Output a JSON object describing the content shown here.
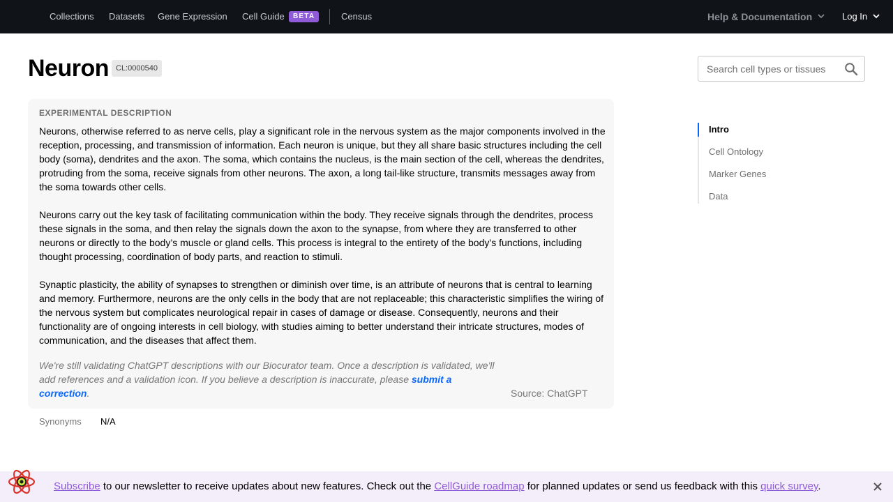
{
  "nav": {
    "links": [
      "Collections",
      "Datasets",
      "Gene Expression",
      "Cell Guide",
      "Census"
    ],
    "beta_badge": "BETA",
    "help": "Help & Documentation",
    "login": "Log In",
    "bg_color": "#101418",
    "beta_color": "#8f5bd6"
  },
  "page": {
    "title": "Neuron",
    "cl_id": "CL:0000540"
  },
  "search": {
    "placeholder": "Search cell types or tissues",
    "value": ""
  },
  "description": {
    "heading": "EXPERIMENTAL DESCRIPTION",
    "paragraphs": [
      "Neurons, otherwise referred to as nerve cells, play a significant role in the nervous system as the major components involved in the reception, processing, and transmission of information. Each neuron is unique, but they all share basic structures including the cell body (soma), dendrites and the axon. The soma, which contains the nucleus, is the main section of the cell, whereas the dendrites, protruding from the soma, receive signals from other neurons. The axon, a long tail-like structure, transmits messages away from the soma towards other cells.",
      "Neurons carry out the key task of facilitating communication within the body. They receive signals through the dendrites, process these signals in the soma, and then relay the signals down the axon to the synapse, from where they are transferred to other neurons or directly to the body’s muscle or gland cells. This process is integral to the entirety of the body’s functions, including thought processing, coordination of body parts, and reaction to stimuli.",
      "Synaptic plasticity, the ability of synapses to strengthen or diminish over time, is an attribute of neurons that is central to learning and memory. Furthermore, neurons are the only cells in the body that are not replaceable; this characteristic simplifies the wiring of the nervous system but complicates neurological repair in cases of damage or disease. Consequently, neurons and their functionality are of ongoing interests in cell biology, with studies aiming to better understand their intricate structures, modes of communication, and the diseases that affect them."
    ],
    "disclaimer": "We're still validating ChatGPT descriptions with our Biocurator team. Once a description is validated, we'll add references and a validation icon. If you believe a description is inaccurate, please ",
    "disclaimer_link": "submit a correction",
    "disclaimer_end": ".",
    "source": "Source: ChatGPT"
  },
  "synonyms": {
    "label": "Synonyms",
    "value": "N/A"
  },
  "toc": {
    "items": [
      "Intro",
      "Cell Ontology",
      "Marker Genes",
      "Data"
    ],
    "active": "Intro",
    "accent_color": "#0b68f8"
  },
  "banner": {
    "link_subscribe": "Subscribe",
    "text_1": " to our newsletter to receive updates about new features. Check out the ",
    "link_roadmap": "CellGuide roadmap",
    "text_2": " for planned updates or send us feedback with this ",
    "link_survey": "quick survey",
    "text_3": ".",
    "bg_color": "#f4eefb",
    "link_color": "#8f5bd6"
  }
}
